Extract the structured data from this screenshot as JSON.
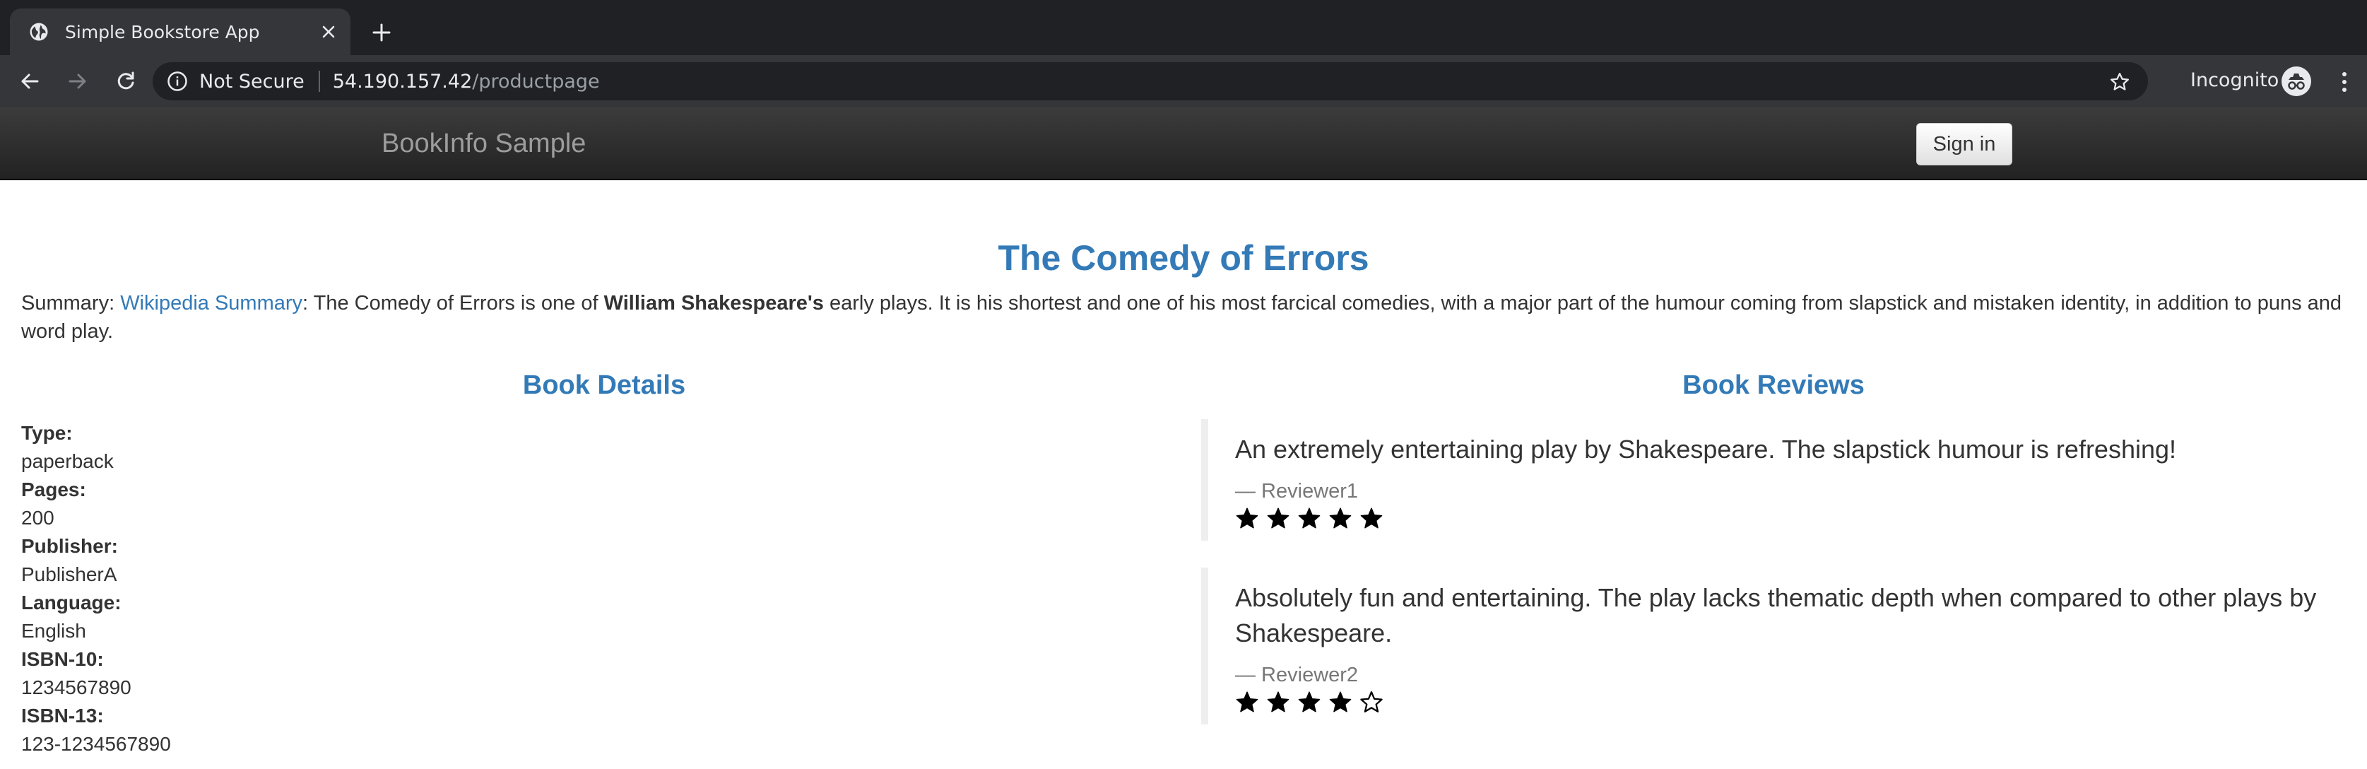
{
  "browser": {
    "tab_title": "Simple Bookstore App",
    "security_label": "Not Secure",
    "url_host": "54.190.157.42",
    "url_path": "/productpage",
    "mode_label": "Incognito"
  },
  "navbar": {
    "brand": "BookInfo Sample",
    "sign_in_label": "Sign in"
  },
  "product": {
    "title": "The Comedy of Errors",
    "summary_label": "Summary: ",
    "summary_link": "Wikipedia Summary",
    "summary_part1": ": The Comedy of Errors is one of ",
    "summary_bold": "William Shakespeare's",
    "summary_part2": " early plays. It is his shortest and one of his most farcical comedies, with a major part of the humour coming from slapstick and mistaken identity, in addition to puns and word play."
  },
  "details": {
    "heading": "Book Details",
    "items": [
      {
        "label": "Type:",
        "value": "paperback"
      },
      {
        "label": "Pages:",
        "value": "200"
      },
      {
        "label": "Publisher:",
        "value": "PublisherA"
      },
      {
        "label": "Language:",
        "value": "English"
      },
      {
        "label": "ISBN-10:",
        "value": "1234567890"
      },
      {
        "label": "ISBN-13:",
        "value": "123-1234567890"
      }
    ]
  },
  "reviews": {
    "heading": "Book Reviews",
    "items": [
      {
        "text": "An extremely entertaining play by Shakespeare. The slapstick humour is refreshing!",
        "author": "— Reviewer1",
        "rating": 5
      },
      {
        "text": "Absolutely fun and entertaining. The play lacks thematic depth when compared to other plays by Shakespeare.",
        "author": "— Reviewer2",
        "rating": 4
      }
    ],
    "max_rating": 5
  },
  "colors": {
    "accent": "#337ab7",
    "text": "#333333",
    "muted": "#777777"
  }
}
